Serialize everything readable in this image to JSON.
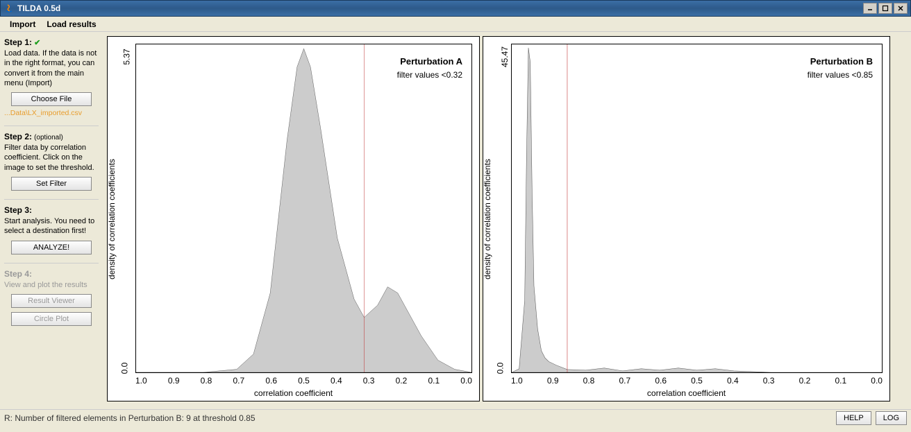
{
  "window": {
    "title": "TILDA 0.5d"
  },
  "menu": {
    "import": "Import",
    "load_results": "Load results"
  },
  "sidebar": {
    "step1": {
      "title": "Step 1:",
      "desc": "Load data. If the data is not in the right format, you can convert it from the main menu (Import)",
      "button": "Choose File",
      "file": "...Data\\LX_imported.csv"
    },
    "step2": {
      "title": "Step 2:",
      "optional": "(optional)",
      "desc": "Filter data by correlation coefficient. Click on the image to set the threshold.",
      "button": "Set Filter"
    },
    "step3": {
      "title": "Step 3:",
      "desc": "Start analysis. You need to select a destination first!",
      "button": "ANALYZE!"
    },
    "step4": {
      "title": "Step 4:",
      "desc": "View and plot the results",
      "button1": "Result Viewer",
      "button2": "Circle Plot"
    }
  },
  "plotA": {
    "title": "Perturbation A",
    "sub": "filter values <0.32",
    "ylabel": "density of correlation coefficients",
    "xlabel": "correlation coefficient",
    "ymin": "0.0",
    "ymax": "5.37",
    "xticks": [
      "1.0",
      "0.9",
      "0.8",
      "0.7",
      "0.6",
      "0.5",
      "0.4",
      "0.3",
      "0.2",
      "0.1",
      "0.0"
    ]
  },
  "plotB": {
    "title": "Perturbation B",
    "sub": "filter values <0.85",
    "ylabel": "density of correlation coefficients",
    "xlabel": "correlation coefficient",
    "ymin": "0.0",
    "ymax": "45.47",
    "xticks": [
      "1.0",
      "0.9",
      "0.8",
      "0.7",
      "0.6",
      "0.5",
      "0.4",
      "0.3",
      "0.2",
      "0.1",
      "0.0"
    ]
  },
  "status": {
    "msg": "R: Number of filtered elements in Perturbation B: 9 at threshold 0.85",
    "help": "HELP",
    "log": "LOG"
  },
  "chart_data": [
    {
      "type": "line",
      "title": "Perturbation A",
      "xlabel": "correlation coefficient",
      "ylabel": "density of correlation coefficients",
      "xlim": [
        1.0,
        0.0
      ],
      "ylim": [
        0.0,
        5.37
      ],
      "threshold_x": 0.32,
      "x": [
        1.0,
        0.9,
        0.8,
        0.7,
        0.65,
        0.6,
        0.55,
        0.52,
        0.5,
        0.48,
        0.45,
        0.4,
        0.35,
        0.32,
        0.28,
        0.25,
        0.22,
        0.2,
        0.15,
        0.1,
        0.05,
        0.0
      ],
      "y": [
        0.0,
        0.0,
        0.0,
        0.05,
        0.3,
        1.3,
        3.8,
        5.0,
        5.3,
        5.0,
        4.0,
        2.2,
        1.2,
        0.9,
        1.1,
        1.4,
        1.3,
        1.1,
        0.6,
        0.2,
        0.05,
        0.0
      ]
    },
    {
      "type": "line",
      "title": "Perturbation B",
      "xlabel": "correlation coefficient",
      "ylabel": "density of correlation coefficients",
      "xlim": [
        1.0,
        0.0
      ],
      "ylim": [
        0.0,
        45.47
      ],
      "threshold_x": 0.85,
      "x": [
        1.0,
        0.98,
        0.965,
        0.96,
        0.955,
        0.95,
        0.945,
        0.94,
        0.93,
        0.92,
        0.91,
        0.9,
        0.88,
        0.85,
        0.8,
        0.75,
        0.7,
        0.65,
        0.6,
        0.55,
        0.5,
        0.45,
        0.4,
        0.3,
        0.2,
        0.1,
        0.0
      ],
      "y": [
        0.0,
        0.5,
        10.0,
        30.0,
        45.0,
        43.0,
        25.0,
        12.0,
        6.0,
        3.0,
        2.0,
        1.5,
        1.0,
        0.4,
        0.3,
        0.6,
        0.2,
        0.5,
        0.3,
        0.6,
        0.3,
        0.5,
        0.2,
        0.0,
        0.0,
        0.0,
        0.0
      ]
    }
  ]
}
